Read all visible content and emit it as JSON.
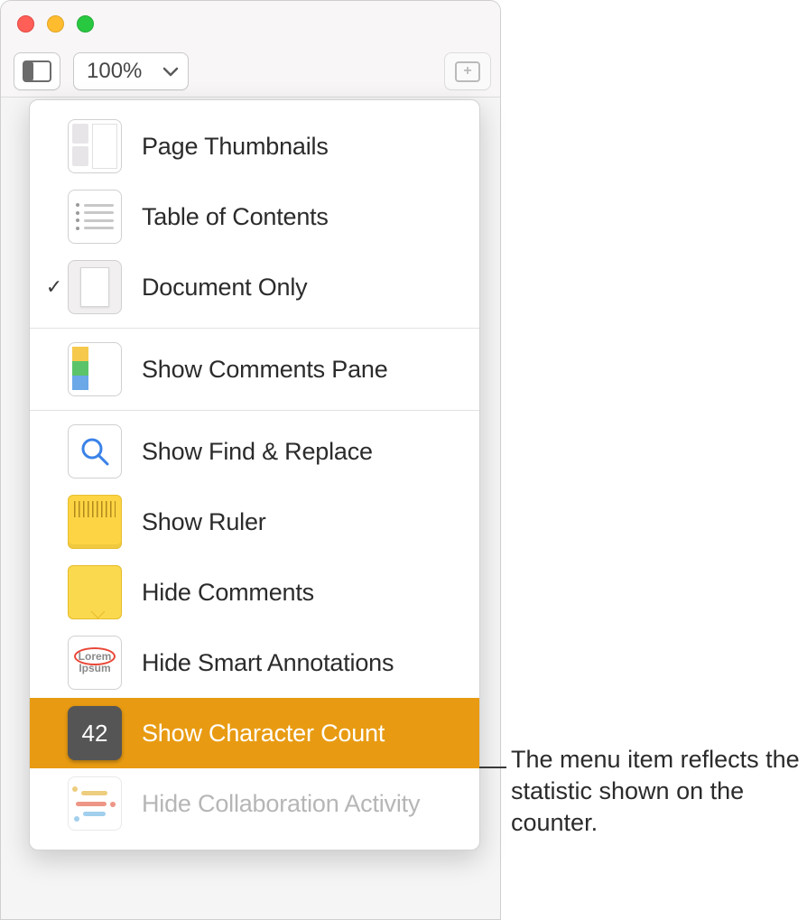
{
  "toolbar": {
    "zoom_value": "100%"
  },
  "menu": {
    "items": [
      {
        "label": "Page Thumbnails",
        "checked": false,
        "highlighted": false,
        "disabled": false
      },
      {
        "label": "Table of Contents",
        "checked": false,
        "highlighted": false,
        "disabled": false
      },
      {
        "label": "Document Only",
        "checked": true,
        "highlighted": false,
        "disabled": false
      },
      {
        "label": "Show Comments Pane",
        "checked": false,
        "highlighted": false,
        "disabled": false
      },
      {
        "label": "Show Find & Replace",
        "checked": false,
        "highlighted": false,
        "disabled": false
      },
      {
        "label": "Show Ruler",
        "checked": false,
        "highlighted": false,
        "disabled": false
      },
      {
        "label": "Hide Comments",
        "checked": false,
        "highlighted": false,
        "disabled": false
      },
      {
        "label": "Hide Smart Annotations",
        "checked": false,
        "highlighted": false,
        "disabled": false
      },
      {
        "label": "Show Character Count",
        "checked": false,
        "highlighted": true,
        "disabled": false
      },
      {
        "label": "Hide Collaboration Activity",
        "checked": false,
        "highlighted": false,
        "disabled": true
      }
    ],
    "count_icon_value": "42",
    "lorem_line1": "Lorem",
    "lorem_line2": "Ipsum"
  },
  "callout": {
    "text": "The menu item reflects the statistic shown on the counter."
  }
}
